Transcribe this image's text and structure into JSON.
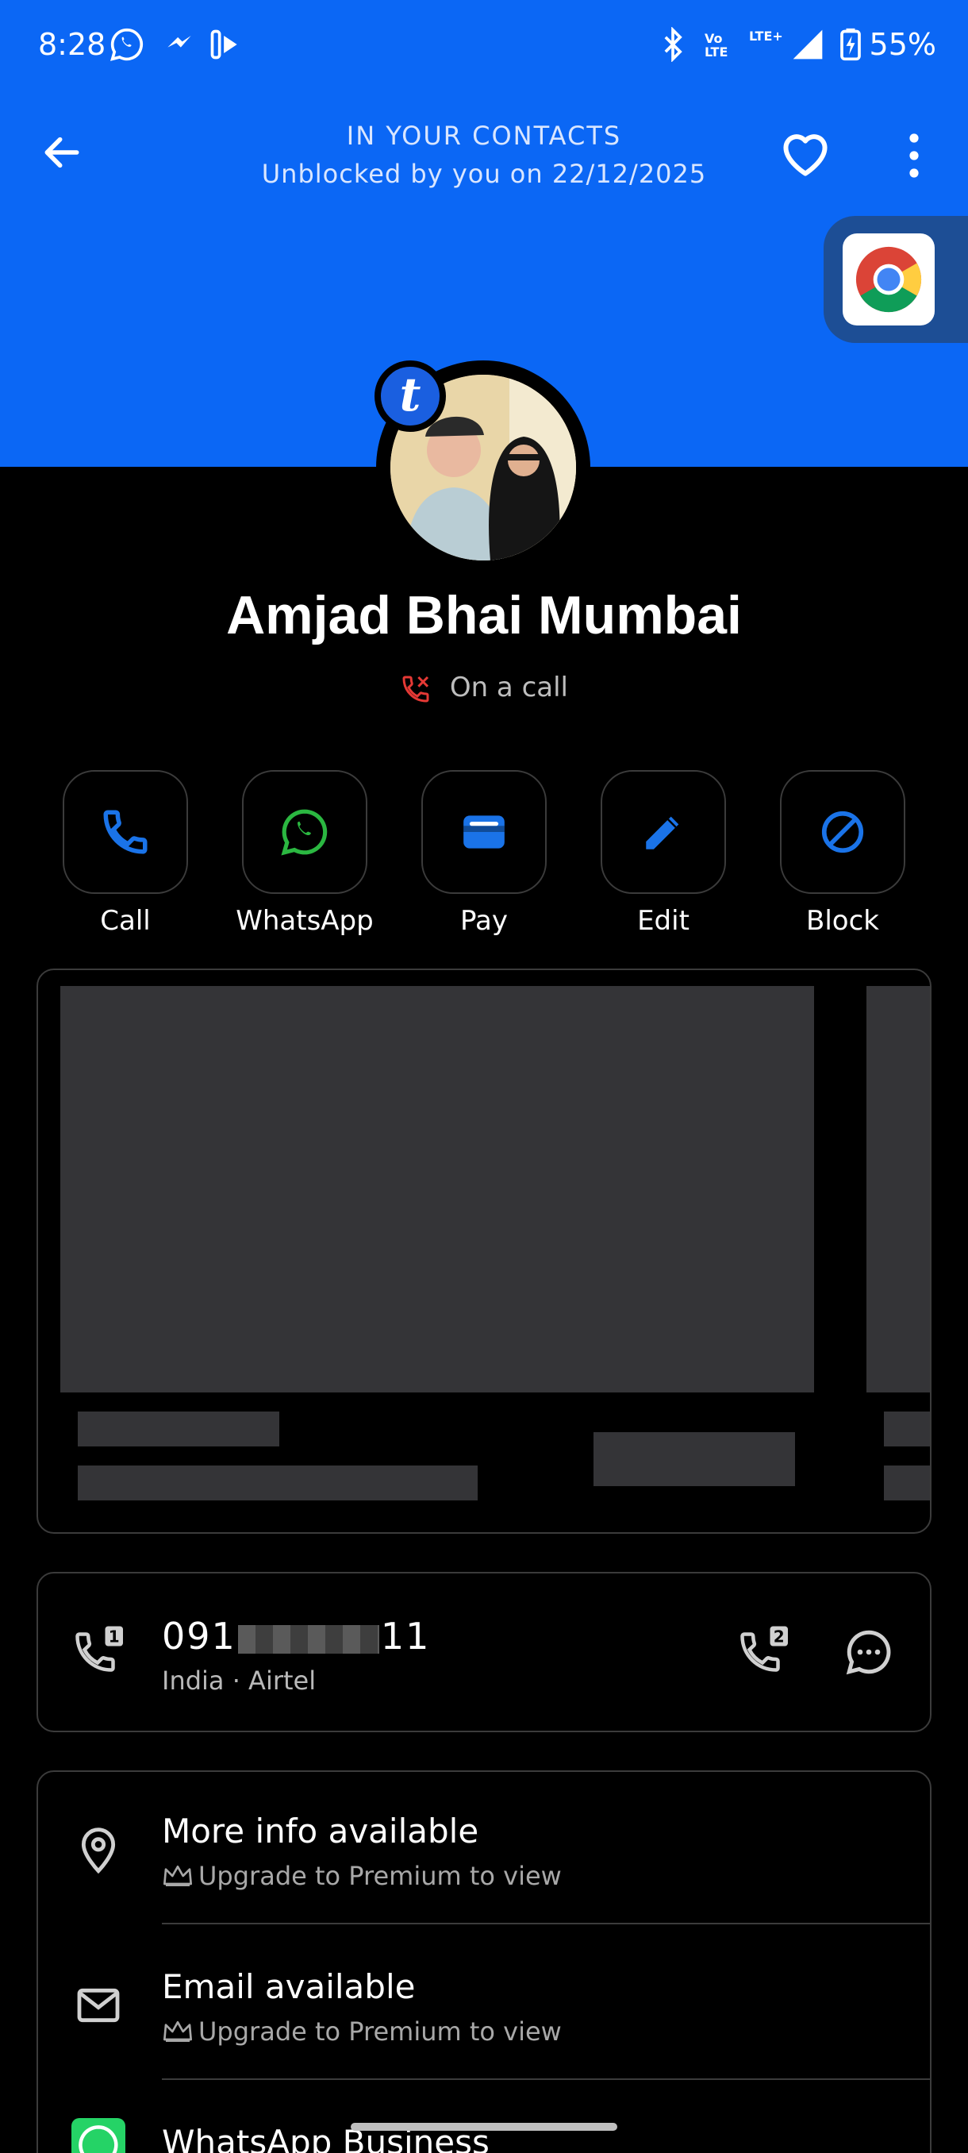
{
  "status_bar": {
    "time": "8:28",
    "battery": "55%",
    "volte_label": "Vo LTE",
    "lte_label": "LTE+",
    "icons": [
      "whatsapp-icon",
      "messenger-icon",
      "media-icon",
      "bluetooth-icon",
      "volte-icon",
      "lte-icon",
      "signal-icon",
      "battery-icon"
    ]
  },
  "header": {
    "line1": "IN YOUR CONTACTS",
    "line2": "Unblocked by you on 22/12/2025",
    "accent": "#0b67f5"
  },
  "contact": {
    "badge_letter": "t",
    "name": "Amjad Bhai Mumbai",
    "call_status": "On a call"
  },
  "actions": [
    {
      "label": "Call",
      "icon": "phone-icon"
    },
    {
      "label": "WhatsApp",
      "icon": "whatsapp-icon"
    },
    {
      "label": "Pay",
      "icon": "wallet-icon"
    },
    {
      "label": "Edit",
      "icon": "pencil-icon"
    },
    {
      "label": "Block",
      "icon": "block-icon"
    }
  ],
  "phone": {
    "number_prefix": "091",
    "number_suffix": "11",
    "sub": "India · Airtel",
    "sim1_label": "1",
    "sim2_label": "2"
  },
  "info": [
    {
      "title": "More info available",
      "sub": "Upgrade to Premium to view",
      "icon": "location-pin-icon"
    },
    {
      "title": "Email available",
      "sub": "Upgrade to Premium to view",
      "icon": "mail-icon"
    },
    {
      "title": "WhatsApp Business",
      "icon": "whatsapp-business-icon"
    }
  ]
}
